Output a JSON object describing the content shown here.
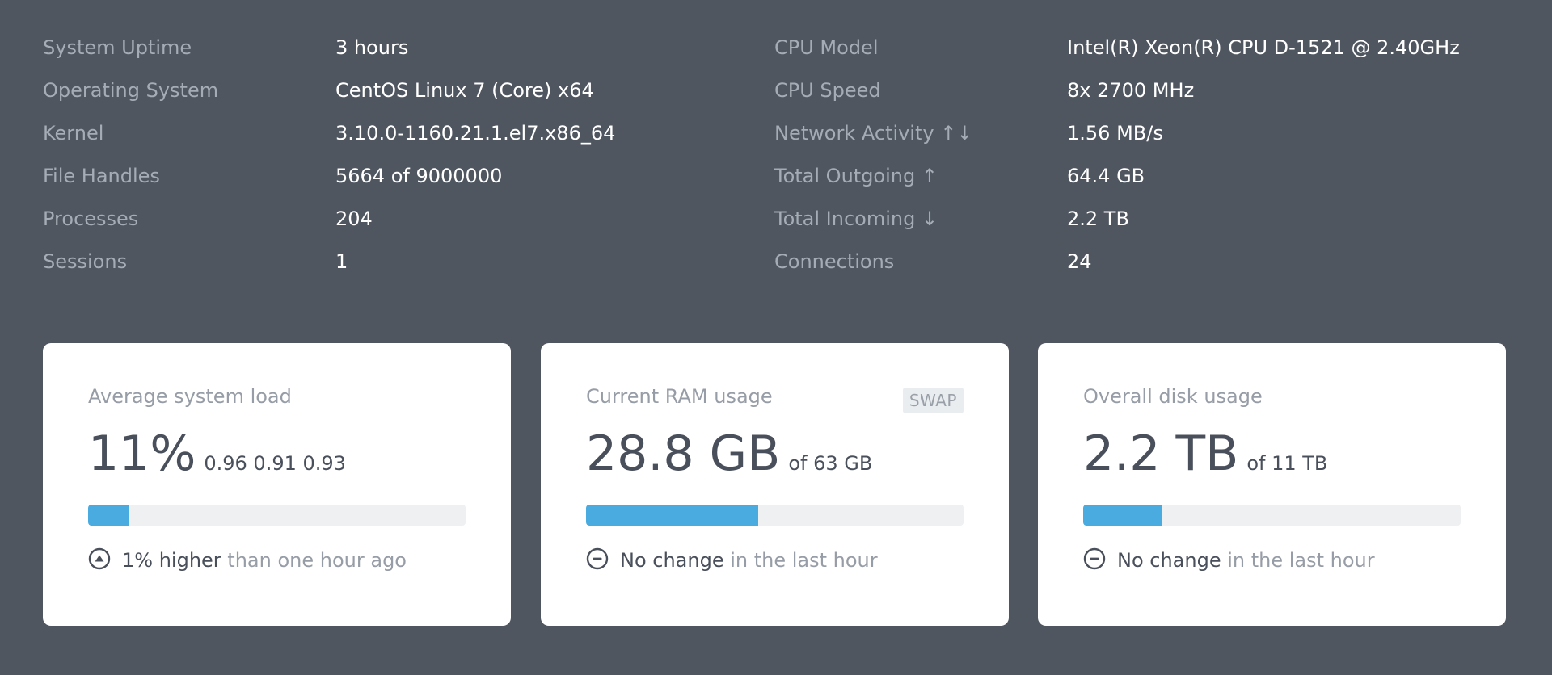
{
  "info_left": [
    {
      "label": "System Uptime",
      "value": "3 hours"
    },
    {
      "label": "Operating System",
      "value": "CentOS Linux 7 (Core) x64"
    },
    {
      "label": "Kernel",
      "value": "3.10.0-1160.21.1.el7.x86_64"
    },
    {
      "label": "File Handles",
      "value": "5664 of 9000000"
    },
    {
      "label": "Processes",
      "value": "204"
    },
    {
      "label": "Sessions",
      "value": "1"
    }
  ],
  "info_right": [
    {
      "label": "CPU Model",
      "value": "Intel(R) Xeon(R) CPU D-1521 @ 2.40GHz"
    },
    {
      "label": "CPU Speed",
      "value": "8x 2700 MHz"
    },
    {
      "label": "Network Activity ↑↓",
      "value": "1.56 MB/s"
    },
    {
      "label": "Total Outgoing ↑",
      "value": "64.4 GB"
    },
    {
      "label": "Total Incoming ↓",
      "value": "2.2 TB"
    },
    {
      "label": "Connections",
      "value": "24"
    }
  ],
  "cards": [
    {
      "title": "Average system load",
      "big": "11%",
      "sub": "0.96 0.91 0.93",
      "progress": 0.11,
      "trend_icon": "arrow-up-circle-icon",
      "trend_strong": "1% higher",
      "trend_light": " than one hour ago"
    },
    {
      "title": "Current RAM usage",
      "badge": "SWAP",
      "big": "28.8 GB",
      "sub": "of 63 GB",
      "progress": 0.457,
      "trend_icon": "minus-circle-icon",
      "trend_strong": "No change",
      "trend_light": " in the last hour"
    },
    {
      "title": "Overall disk usage",
      "big": "2.2 TB",
      "sub": "of 11 TB",
      "progress": 0.21,
      "trend_icon": "minus-circle-icon",
      "trend_strong": "No change",
      "trend_light": " in the last hour"
    }
  ],
  "colors": {
    "background": "#4f5660",
    "card": "#ffffff",
    "progress_fill": "#4aabe1",
    "progress_track": "#eef0f2"
  }
}
